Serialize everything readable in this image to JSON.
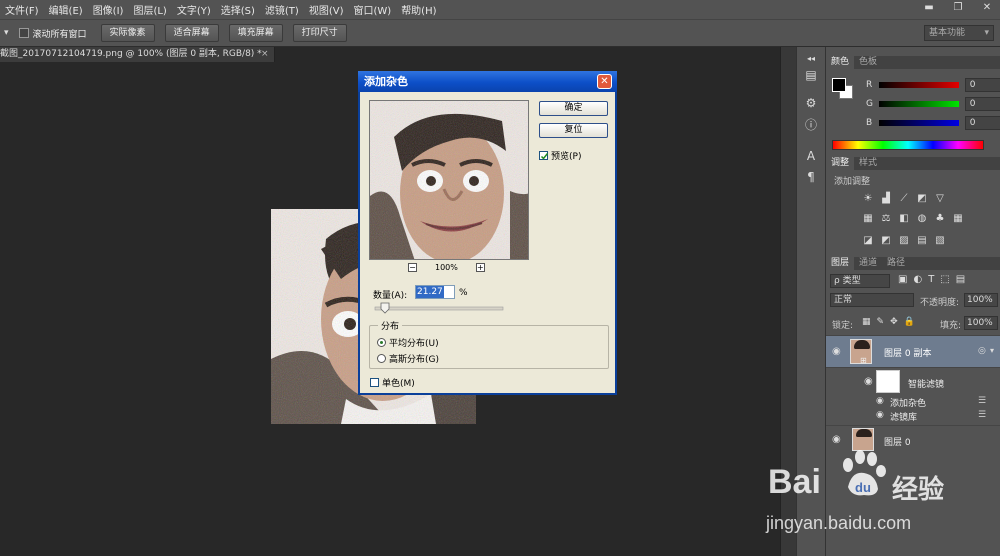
{
  "menubar": {
    "items": [
      "文件(F)",
      "编辑(E)",
      "图像(I)",
      "图层(L)",
      "文字(Y)",
      "选择(S)",
      "滤镜(T)",
      "视图(V)",
      "窗口(W)",
      "帮助(H)"
    ],
    "window_controls": {
      "minimize": "▬",
      "restore": "❐",
      "close": "✕"
    }
  },
  "options_bar": {
    "tool_arrow": "▾",
    "scroll_all_windows": "滚动所有窗口",
    "btn_actual_pixels": "实际像素",
    "btn_fit_screen": "适合屏幕",
    "btn_fill_screen": "填充屏幕",
    "btn_print_size": "打印尺寸",
    "workspace": "基本功能",
    "workspace_arrow": "▾"
  },
  "document": {
    "tab_title": "截图_20170712104719.png @ 100% (图层 0 副本, RGB/8) *",
    "close_glyph": "×"
  },
  "dialog": {
    "title": "添加杂色",
    "ok": "确定",
    "reset": "复位",
    "preview_label": "预览(P)",
    "zoom_out": "−",
    "zoom_in": "+",
    "zoom_level": "100%",
    "amount_label": "数量(A):",
    "amount_value": "21.27",
    "amount_unit": "%",
    "amount_fraction": 0.05,
    "distribution_label": "分布",
    "uniform": "平均分布(U)",
    "gaussian": "高斯分布(G)",
    "monochrome": "单色(M)",
    "close_glyph": "✕"
  },
  "panels": {
    "color_tabs": [
      "颜色",
      "色板"
    ],
    "channels": [
      {
        "label": "R",
        "value": "0",
        "grad_from": "#000000",
        "grad_to": "#ff0000"
      },
      {
        "label": "G",
        "value": "0",
        "grad_from": "#000000",
        "grad_to": "#00ff00"
      },
      {
        "label": "B",
        "value": "0",
        "grad_from": "#000000",
        "grad_to": "#0000ff"
      }
    ],
    "adjust_tabs": [
      "调整",
      "样式"
    ],
    "add_adjustment": "添加调整",
    "layers_tabs": [
      "图层",
      "通道",
      "路径"
    ],
    "filter_type": "ρ 类型",
    "blend_mode": "正常",
    "opacity_label": "不透明度:",
    "opacity_value": "100%",
    "lock_label": "锁定:",
    "fill_label": "填充:",
    "fill_value": "100%",
    "layers": {
      "copy": "图层 0 副本",
      "smart_filters": "智能滤镜",
      "filter_noise": "添加杂色",
      "filter_gallery": "滤镜库",
      "base": "图层 0"
    }
  },
  "watermark": {
    "brand": "Bai",
    "brand_suffix": "经验",
    "url": "jingyan.baidu.com"
  },
  "colors": {
    "accent_selection": "#316ac5",
    "title_bar": "#0d4fc8",
    "ui_panel": "#535353"
  }
}
